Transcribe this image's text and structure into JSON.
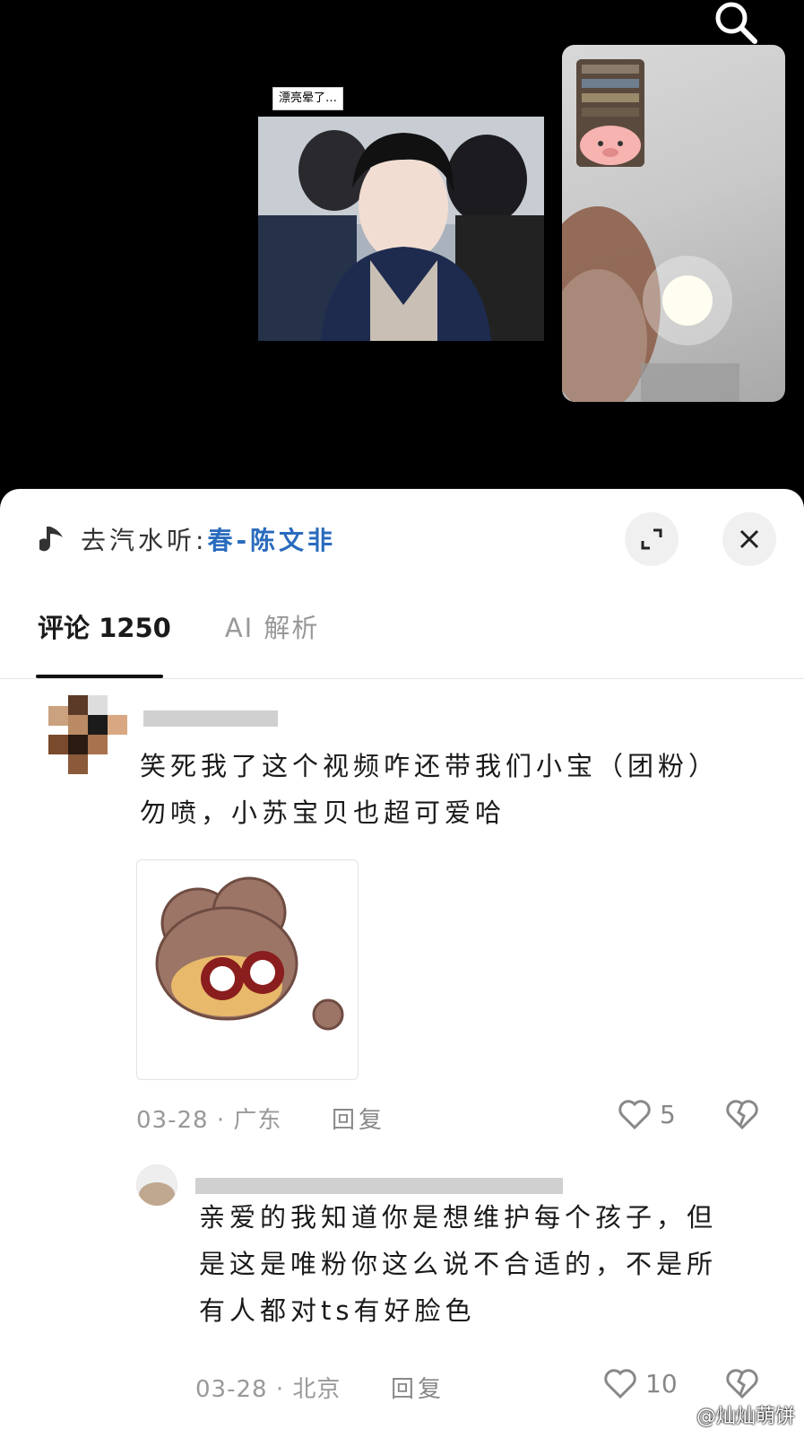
{
  "video": {
    "caption": "漂亮晕了…",
    "search_icon": "search-icon"
  },
  "music": {
    "prefix": "去汽水听:",
    "song": "春-陈文非",
    "icon": "music-note-icon"
  },
  "tabs": {
    "comments": "评论 1250",
    "ai": "AI 解析"
  },
  "comments": [
    {
      "text_line1": "笑死我了这个视频咋还带我们小宝（团粉）",
      "text_line2": "勿喷，小苏宝贝也超可爱哈",
      "date": "03-28 · 广东",
      "reply": "回复",
      "likes": "5"
    },
    {
      "text_line1": "亲爱的我知道你是想维护每个孩子，但",
      "text_line2": "是这是唯粉你这么说不合适的，不是所",
      "text_line3": "有人都对ts有好脸色",
      "date": "03-28 · 北京",
      "reply": "回复",
      "likes": "10"
    }
  ],
  "watermark": "@灿灿萌饼",
  "colors": {
    "link_blue": "#2a6bbd",
    "muted": "#999999",
    "background_dark": "#000000"
  }
}
